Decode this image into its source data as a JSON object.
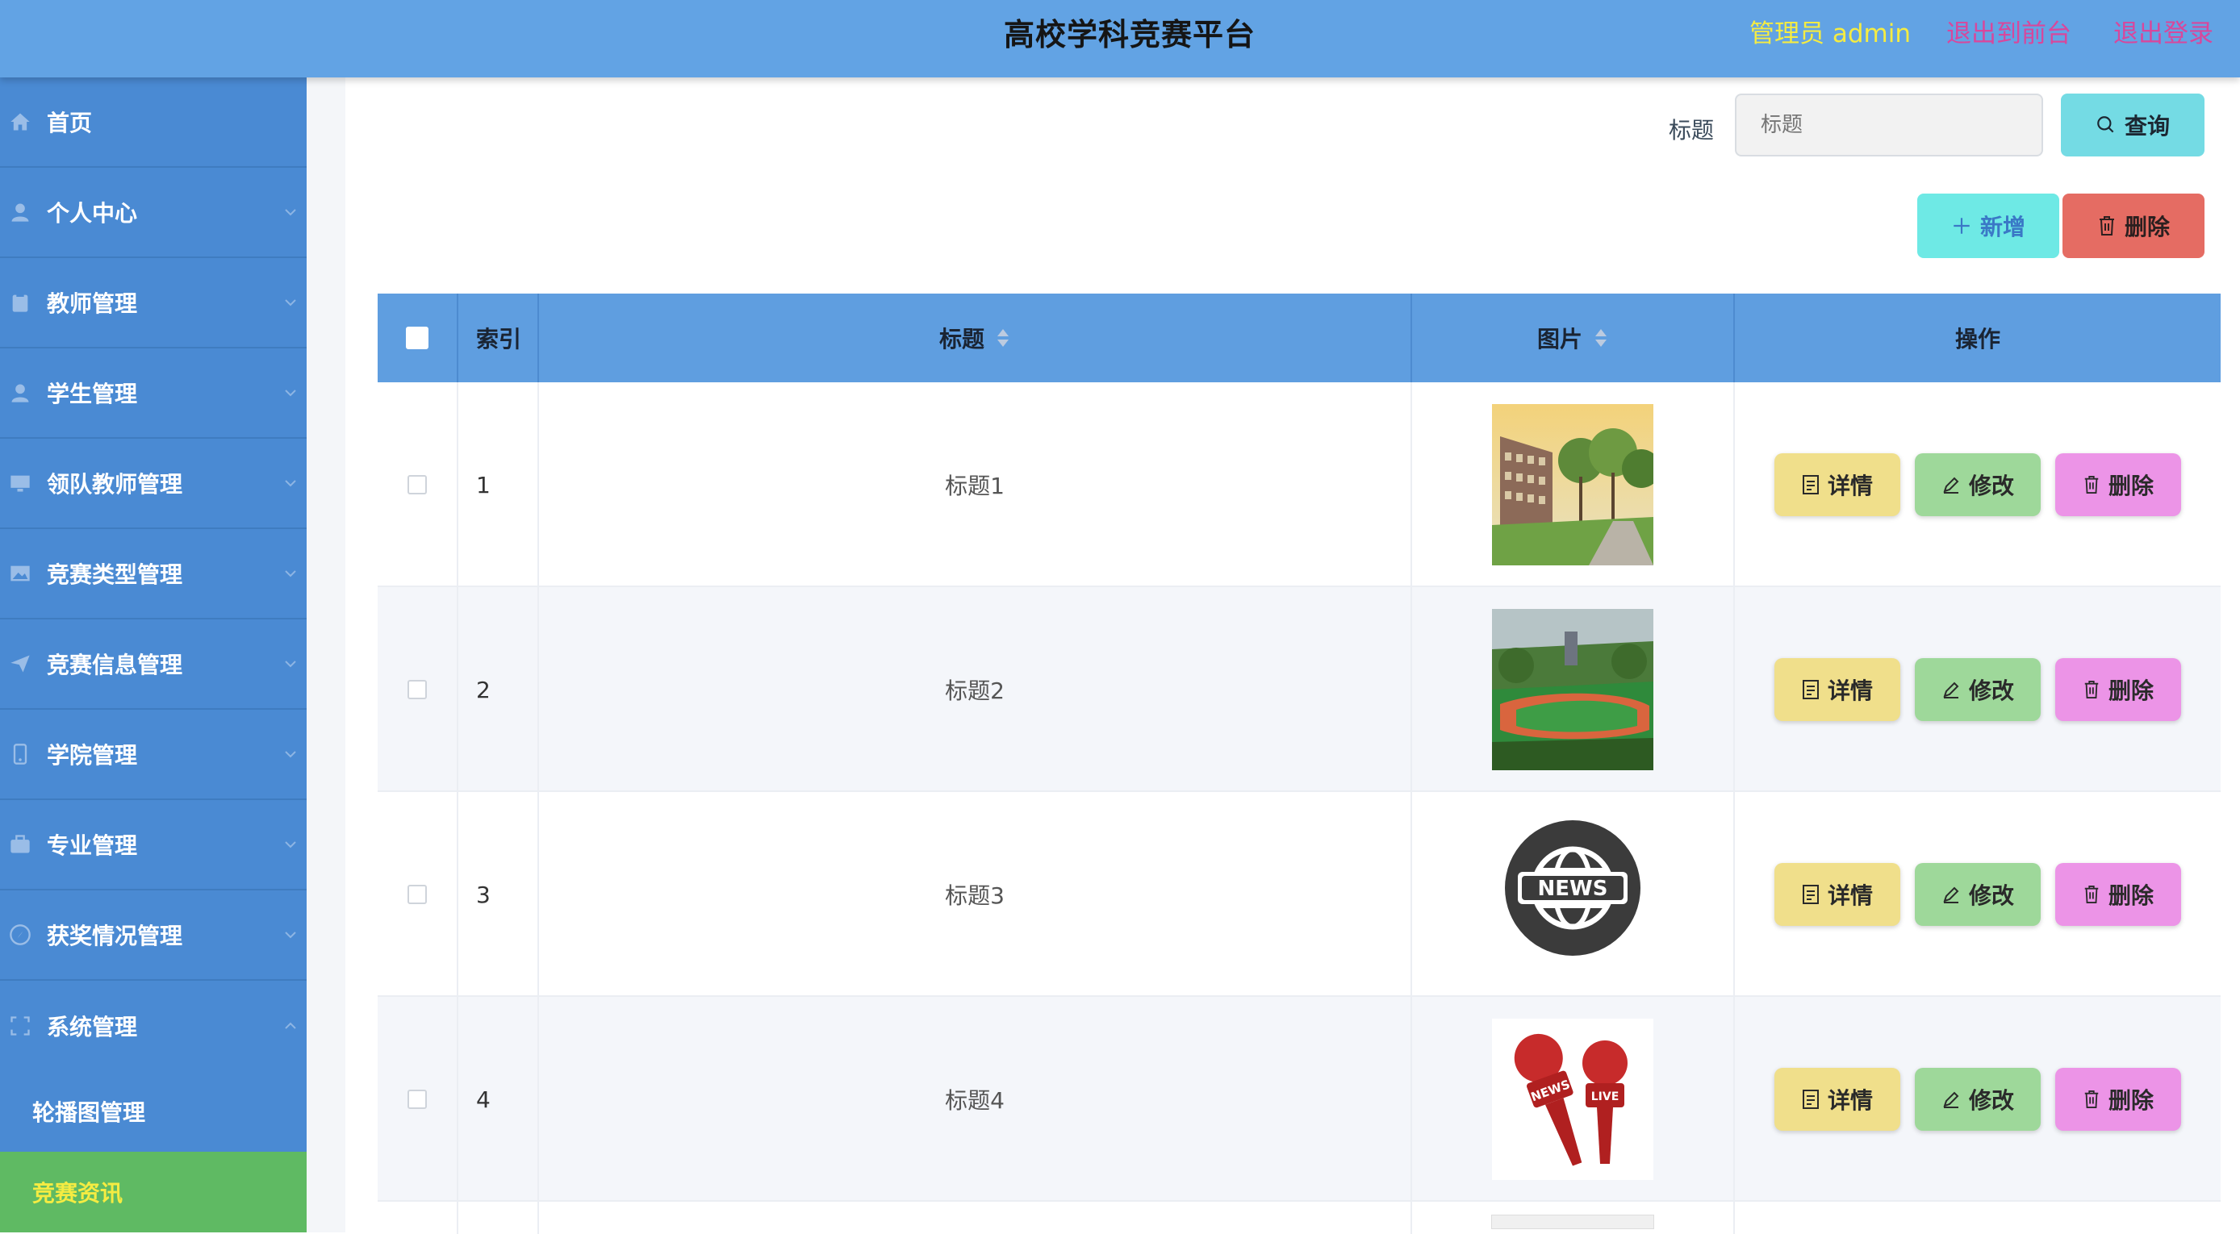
{
  "header": {
    "title": "高校学科竞赛平台",
    "admin_label": "管理员 admin",
    "back_to_front": "退出到前台",
    "logout": "退出登录"
  },
  "sidebar": {
    "items": [
      {
        "label": "首页",
        "icon": "home-icon"
      },
      {
        "label": "个人中心",
        "icon": "user-icon"
      },
      {
        "label": "教师管理",
        "icon": "clipboard-icon"
      },
      {
        "label": "学生管理",
        "icon": "user-icon"
      },
      {
        "label": "领队教师管理",
        "icon": "monitor-icon"
      },
      {
        "label": "竞赛类型管理",
        "icon": "picture-icon"
      },
      {
        "label": "竞赛信息管理",
        "icon": "send-icon"
      },
      {
        "label": "学院管理",
        "icon": "phone-icon"
      },
      {
        "label": "专业管理",
        "icon": "suitcase-icon"
      },
      {
        "label": "获奖情况管理",
        "icon": "compass-icon"
      },
      {
        "label": "系统管理",
        "icon": "fullscreen-icon"
      }
    ],
    "sub_items": [
      {
        "label": "轮播图管理",
        "active": false
      },
      {
        "label": "竞赛资讯",
        "active": true
      }
    ]
  },
  "search": {
    "label": "标题",
    "placeholder": "标题",
    "query_button": "查询"
  },
  "actions": {
    "add_button": "新增",
    "delete_button": "删除"
  },
  "table": {
    "headers": {
      "index": "索引",
      "title": "标题",
      "image": "图片",
      "operations": "操作"
    },
    "rows": [
      {
        "index": "1",
        "title": "标题1",
        "image": "campus-building-photo"
      },
      {
        "index": "2",
        "title": "标题2",
        "image": "sports-field-photo"
      },
      {
        "index": "3",
        "title": "标题3",
        "image": "news-globe-badge"
      },
      {
        "index": "4",
        "title": "标题4",
        "image": "news-live-microphones"
      }
    ],
    "row_buttons": {
      "detail": "详情",
      "edit": "修改",
      "delete": "删除"
    }
  },
  "colors": {
    "topbar": "#62a3e4",
    "sidebar": "#4a8ad3",
    "active_menu": "#5fba63",
    "accent_yellow": "#f5ec42",
    "accent_pink": "#d8479c"
  }
}
